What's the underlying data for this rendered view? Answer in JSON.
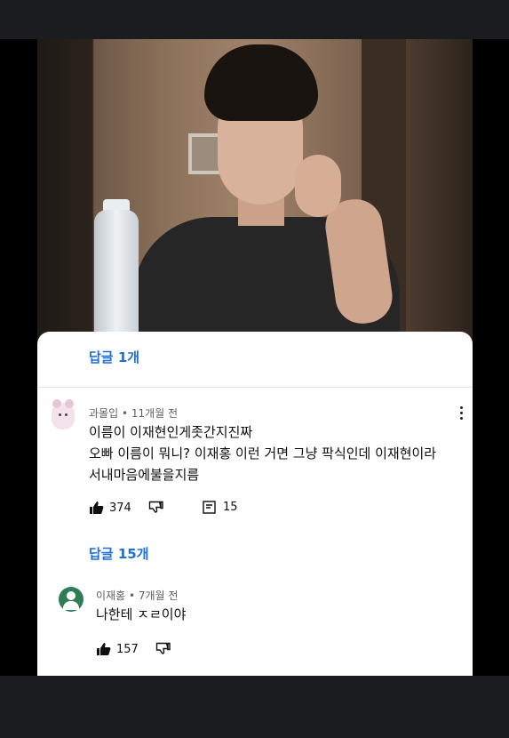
{
  "colors": {
    "link": "#1e6fd9",
    "meta": "#606060",
    "text": "#0f0f0f",
    "avatar_green": "#2e7d57"
  },
  "photo": {
    "description_icon": "video-thumbnail"
  },
  "replies_top": {
    "label": "답글 1개"
  },
  "comment": {
    "author": "과몰입",
    "time": "11개월 전",
    "lines": [
      "이름이 이재현인게좃간지진짜",
      "오빠 이름이 뭐니? 이재홍 이런 거면 그냥 팍식인데 이재현이라",
      "서내마음에불을지름"
    ],
    "likes": "374",
    "replies_count": "15",
    "replies_label": "답글 15개"
  },
  "reply": {
    "author": "이재홍",
    "time": "7개월 전",
    "text": "나한테 ㅈㄹ이야",
    "likes": "157"
  },
  "icons": {
    "like": "thumbs-up-icon",
    "dislike": "thumbs-down-icon",
    "reply": "comment-icon",
    "more": "more-vertical-icon"
  }
}
